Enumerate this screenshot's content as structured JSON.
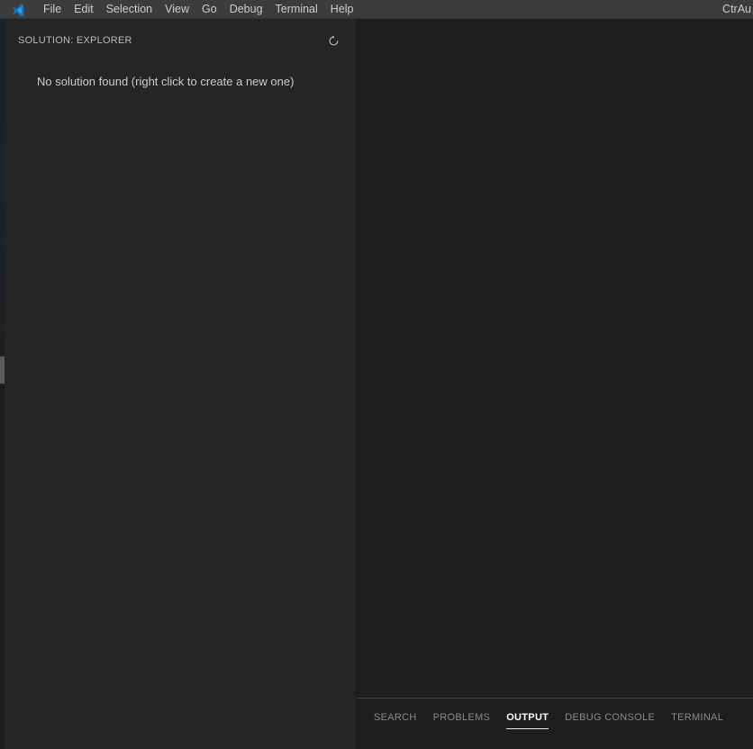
{
  "window": {
    "titlebar_bg": "#3c3c3c",
    "sidebar_bg": "#252526",
    "editor_bg": "#1e1e1e",
    "accent": "#007acc",
    "active_tab_color": "#ffffff",
    "inactive_tab_color": "#8a8a8a"
  },
  "titlebar": {
    "logo_icon": "vscode-logo-icon",
    "menu": [
      {
        "label": "File",
        "name": "menu-file"
      },
      {
        "label": "Edit",
        "name": "menu-edit"
      },
      {
        "label": "Selection",
        "name": "menu-selection"
      },
      {
        "label": "View",
        "name": "menu-view"
      },
      {
        "label": "Go",
        "name": "menu-go"
      },
      {
        "label": "Debug",
        "name": "menu-debug"
      },
      {
        "label": "Terminal",
        "name": "menu-terminal"
      },
      {
        "label": "Help",
        "name": "menu-help"
      }
    ],
    "right_hint": "CtrAu"
  },
  "sidebar": {
    "title": "SOLUTION: EXPLORER",
    "refresh_icon": "refresh-icon",
    "empty_message": "No solution found (right click to create a new one)"
  },
  "editor": {
    "content": ""
  },
  "panel": {
    "tabs": [
      {
        "label": "SEARCH",
        "name": "panel-tab-search",
        "active": false
      },
      {
        "label": "PROBLEMS",
        "name": "panel-tab-problems",
        "active": false
      },
      {
        "label": "OUTPUT",
        "name": "panel-tab-output",
        "active": true
      },
      {
        "label": "DEBUG CONSOLE",
        "name": "panel-tab-debug-console",
        "active": false
      },
      {
        "label": "TERMINAL",
        "name": "panel-tab-terminal",
        "active": false
      }
    ],
    "content": ""
  }
}
